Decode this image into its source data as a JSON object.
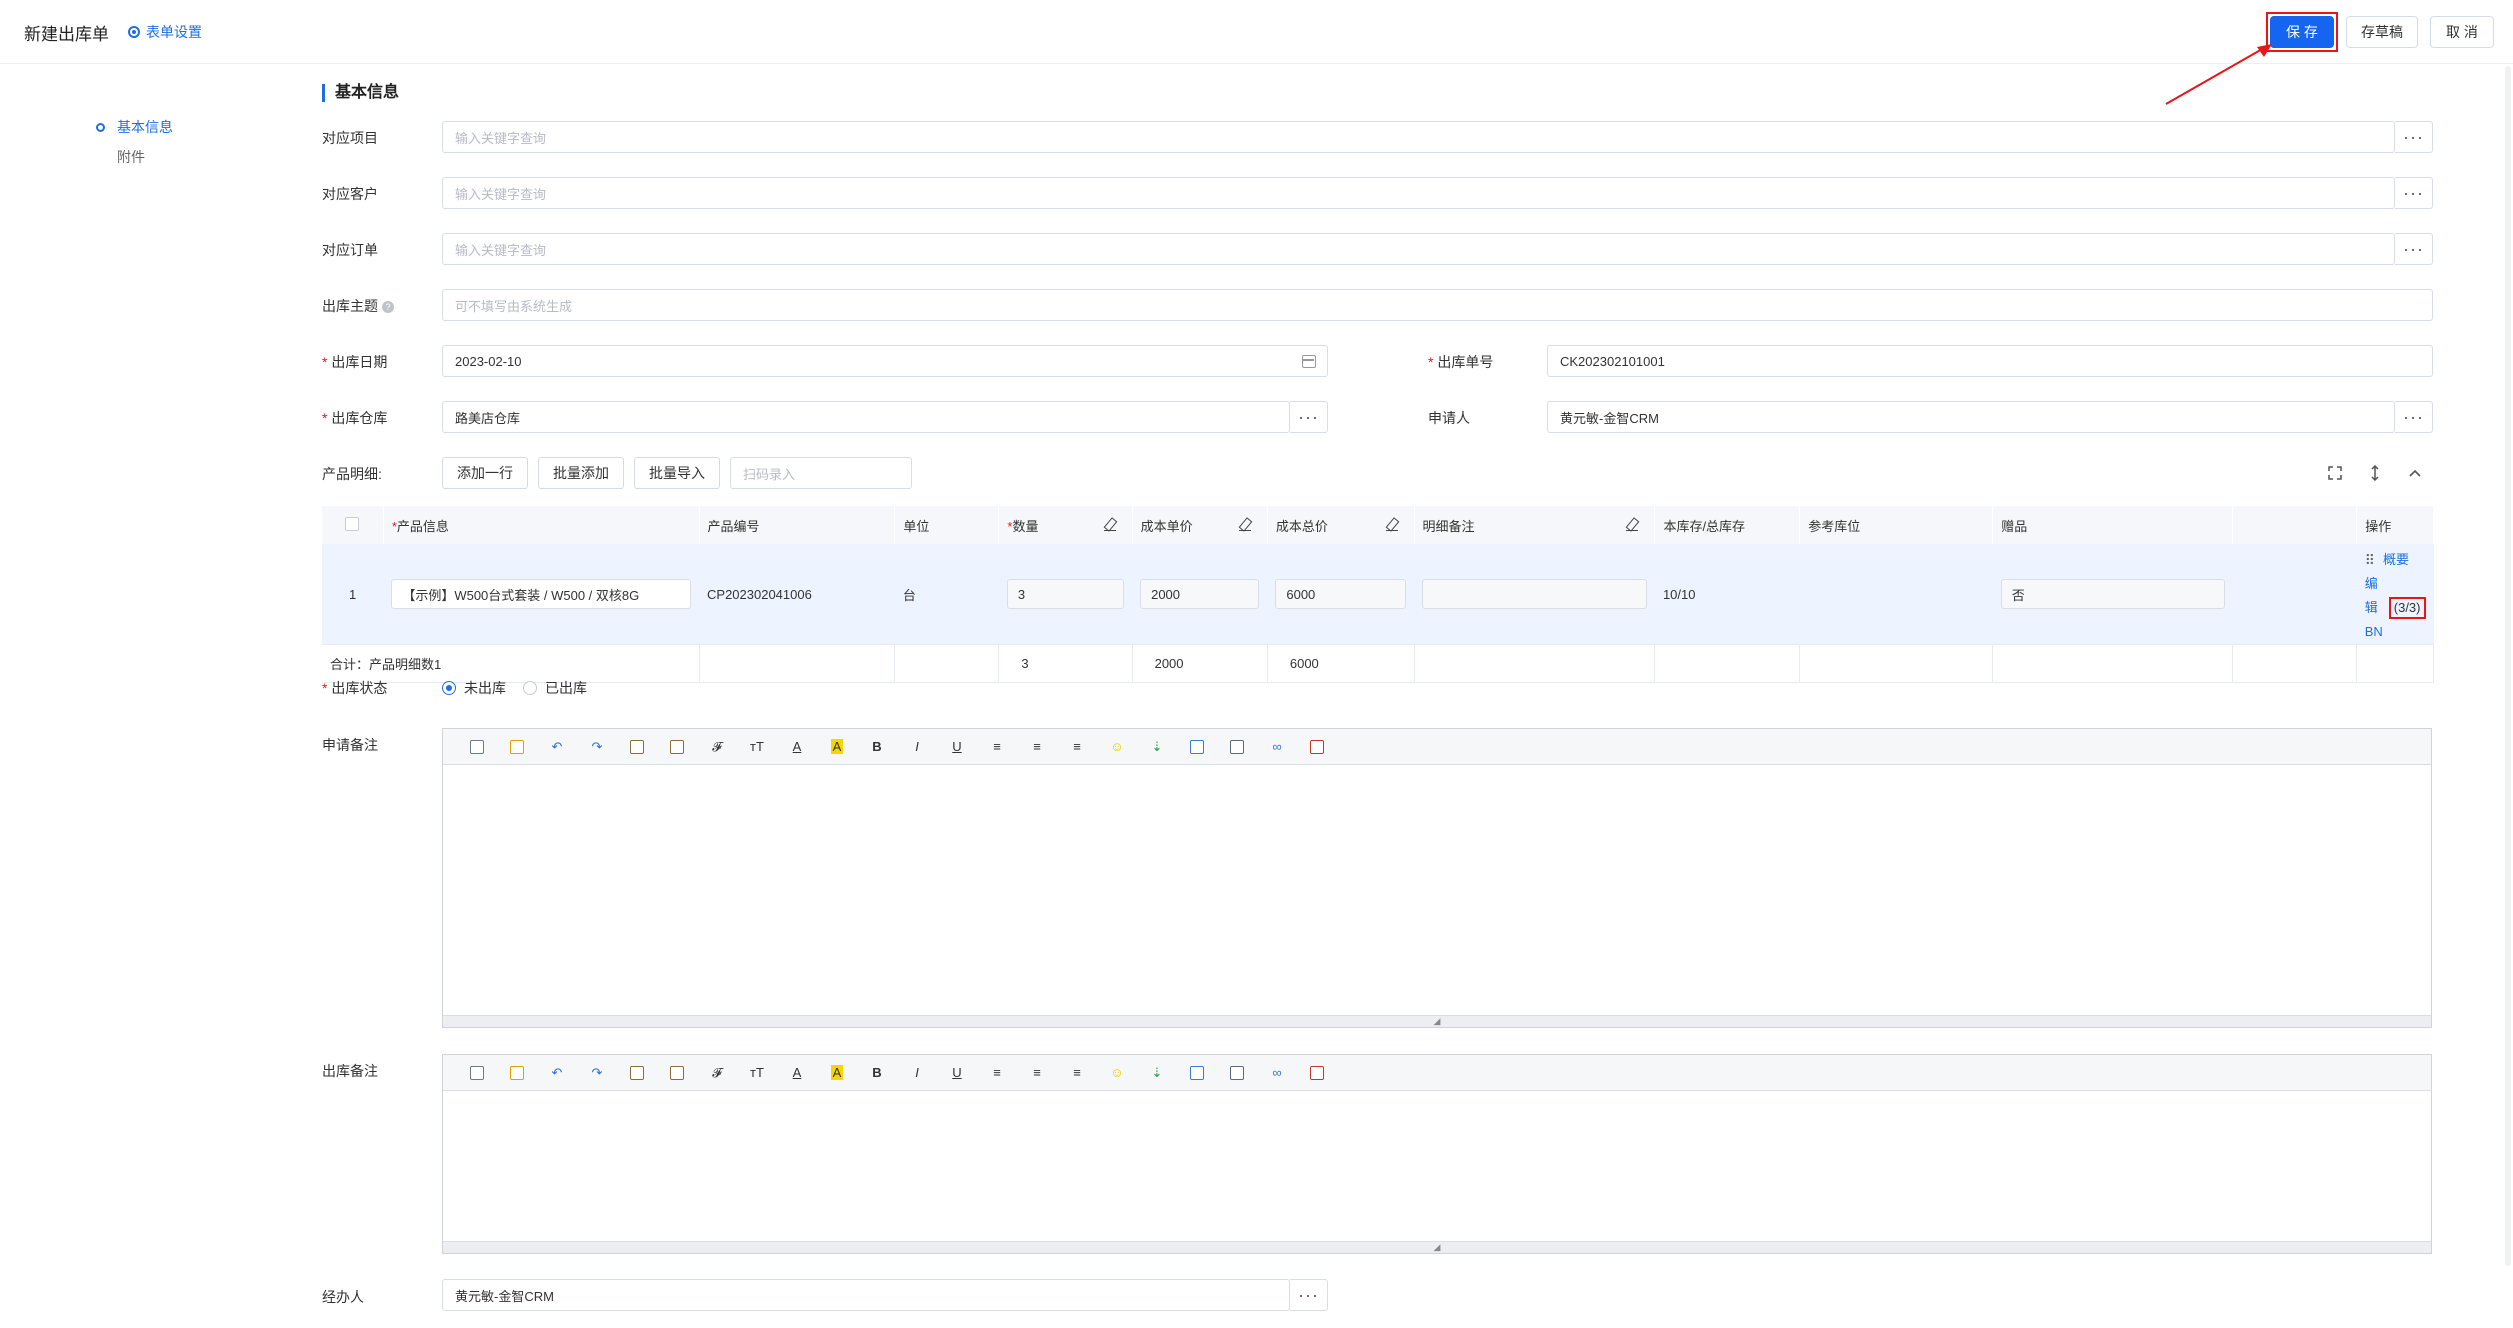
{
  "header": {
    "title": "新建出库单",
    "form_settings": "表单设置",
    "save": "保 存",
    "draft": "存草稿",
    "cancel": "取 消"
  },
  "nav": {
    "items": [
      {
        "label": "基本信息",
        "active": true
      },
      {
        "label": "附件",
        "active": false
      }
    ]
  },
  "section_title": "基本信息",
  "form": {
    "project": {
      "label": "对应项目",
      "placeholder": "输入关键字查询"
    },
    "customer": {
      "label": "对应客户",
      "placeholder": "输入关键字查询"
    },
    "order": {
      "label": "对应订单",
      "placeholder": "输入关键字查询"
    },
    "subject": {
      "label": "出库主题",
      "placeholder": "可不填写由系统生成"
    },
    "date": {
      "label": "出库日期",
      "value": "2023-02-10"
    },
    "number": {
      "label": "出库单号",
      "value": "CK202302101001"
    },
    "warehouse": {
      "label": "出库仓库",
      "value": "路美店仓库"
    },
    "applicant": {
      "label": "申请人",
      "value": "黄元敏-金智CRM"
    },
    "products_label": "产品明细:",
    "status": {
      "label": "出库状态",
      "options": [
        "未出库",
        "已出库"
      ],
      "selected": "未出库"
    },
    "apply_note_label": "申请备注",
    "out_note_label": "出库备注",
    "handler": {
      "label": "经办人",
      "value": "黄元敏-金智CRM"
    }
  },
  "toolbar": {
    "add_row": "添加一行",
    "batch_add": "批量添加",
    "batch_import": "批量导入",
    "scan_placeholder": "扫码录入"
  },
  "table": {
    "headers": [
      "产品信息",
      "产品编号",
      "单位",
      "数量",
      "成本单价",
      "成本总价",
      "明细备注",
      "本库存/总库存",
      "参考库位",
      "赠品",
      "操作"
    ],
    "rows": [
      {
        "index": "1",
        "product": "【示例】W500台式套装 / W500 / 双核8G",
        "code": "CP202302041006",
        "unit": "台",
        "qty": "3",
        "unit_price": "2000",
        "total": "6000",
        "note": "",
        "stock": "10/10",
        "location": "",
        "gift": "否",
        "op_summary": "概要",
        "op_edit": "编辑BN",
        "op_count": "(3/3)"
      }
    ],
    "summary": {
      "label": "合计：产品明细数1",
      "qty": "3",
      "unit_price": "2000",
      "total": "6000"
    }
  },
  "colors": {
    "primary": "#1565f0",
    "highlight": "#e8161a",
    "stock": "#17a86b"
  },
  "editor_toolbar_icons": [
    "source-icon",
    "template-icon",
    "undo-icon",
    "redo-icon",
    "paste-icon",
    "paste-text-icon",
    "clear-format-icon",
    "font-size-icon",
    "font-color-icon",
    "bg-color-icon",
    "bold-icon",
    "italic-icon",
    "underline-icon",
    "align-left-icon",
    "align-center-icon",
    "align-right-icon",
    "emoji-icon",
    "insert-icon",
    "table-icon",
    "image-icon",
    "link-icon",
    "unlink-icon"
  ]
}
